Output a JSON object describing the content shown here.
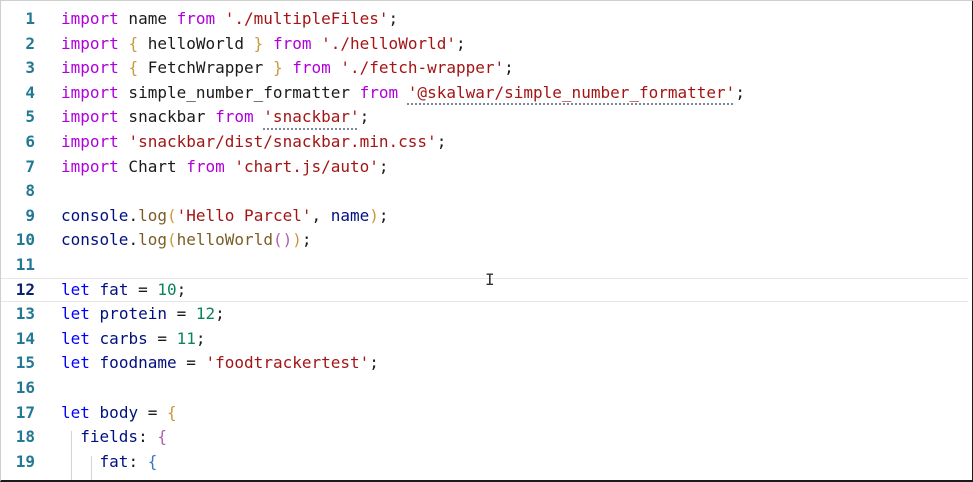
{
  "editor": {
    "lines": [
      {
        "n": "1",
        "tokens": [
          {
            "t": "import",
            "c": "ctrl"
          },
          {
            "t": " name ",
            "c": "plain"
          },
          {
            "t": "from",
            "c": "ctrl"
          },
          {
            "t": " ",
            "c": "plain"
          },
          {
            "t": "'./multipleFiles'",
            "c": "str"
          },
          {
            "t": ";",
            "c": "plain"
          }
        ]
      },
      {
        "n": "2",
        "tokens": [
          {
            "t": "import",
            "c": "ctrl"
          },
          {
            "t": " ",
            "c": "plain"
          },
          {
            "t": "{",
            "c": "br1"
          },
          {
            "t": " helloWorld ",
            "c": "plain"
          },
          {
            "t": "}",
            "c": "br1"
          },
          {
            "t": " ",
            "c": "plain"
          },
          {
            "t": "from",
            "c": "ctrl"
          },
          {
            "t": " ",
            "c": "plain"
          },
          {
            "t": "'./helloWorld'",
            "c": "str"
          },
          {
            "t": ";",
            "c": "plain"
          }
        ]
      },
      {
        "n": "3",
        "tokens": [
          {
            "t": "import",
            "c": "ctrl"
          },
          {
            "t": " ",
            "c": "plain"
          },
          {
            "t": "{",
            "c": "br1"
          },
          {
            "t": " FetchWrapper ",
            "c": "plain"
          },
          {
            "t": "}",
            "c": "br1"
          },
          {
            "t": " ",
            "c": "plain"
          },
          {
            "t": "from",
            "c": "ctrl"
          },
          {
            "t": " ",
            "c": "plain"
          },
          {
            "t": "'./fetch-wrapper'",
            "c": "str"
          },
          {
            "t": ";",
            "c": "plain"
          }
        ]
      },
      {
        "n": "4",
        "tokens": [
          {
            "t": "import",
            "c": "ctrl"
          },
          {
            "t": " simple_number_formatter ",
            "c": "plain"
          },
          {
            "t": "from",
            "c": "ctrl"
          },
          {
            "t": " ",
            "c": "plain"
          },
          {
            "t": "'@skalwar/simple_number_formatter'",
            "c": "str squig"
          },
          {
            "t": ";",
            "c": "plain"
          }
        ]
      },
      {
        "n": "5",
        "tokens": [
          {
            "t": "import",
            "c": "ctrl"
          },
          {
            "t": " snackbar ",
            "c": "plain"
          },
          {
            "t": "from",
            "c": "ctrl"
          },
          {
            "t": " ",
            "c": "plain"
          },
          {
            "t": "'snackbar'",
            "c": "str squig"
          },
          {
            "t": ";",
            "c": "plain"
          }
        ]
      },
      {
        "n": "6",
        "tokens": [
          {
            "t": "import",
            "c": "ctrl"
          },
          {
            "t": " ",
            "c": "plain"
          },
          {
            "t": "'snackbar/dist/snackbar.min.css'",
            "c": "str"
          },
          {
            "t": ";",
            "c": "plain"
          }
        ]
      },
      {
        "n": "7",
        "tokens": [
          {
            "t": "import",
            "c": "ctrl"
          },
          {
            "t": " Chart ",
            "c": "plain"
          },
          {
            "t": "from",
            "c": "ctrl"
          },
          {
            "t": " ",
            "c": "plain"
          },
          {
            "t": "'chart.js/auto'",
            "c": "str"
          },
          {
            "t": ";",
            "c": "plain"
          }
        ]
      },
      {
        "n": "8",
        "tokens": []
      },
      {
        "n": "9",
        "tokens": [
          {
            "t": "console",
            "c": "id"
          },
          {
            "t": ".",
            "c": "plain"
          },
          {
            "t": "log",
            "c": "fn"
          },
          {
            "t": "(",
            "c": "br1"
          },
          {
            "t": "'Hello Parcel'",
            "c": "str"
          },
          {
            "t": ", ",
            "c": "plain"
          },
          {
            "t": "name",
            "c": "id"
          },
          {
            "t": ")",
            "c": "br1"
          },
          {
            "t": ";",
            "c": "plain"
          }
        ]
      },
      {
        "n": "10",
        "tokens": [
          {
            "t": "console",
            "c": "id"
          },
          {
            "t": ".",
            "c": "plain"
          },
          {
            "t": "log",
            "c": "fn"
          },
          {
            "t": "(",
            "c": "br1"
          },
          {
            "t": "helloWorld",
            "c": "fn"
          },
          {
            "t": "()",
            "c": "br2"
          },
          {
            "t": ")",
            "c": "br1"
          },
          {
            "t": ";",
            "c": "plain"
          }
        ]
      },
      {
        "n": "11",
        "tokens": []
      },
      {
        "n": "12",
        "current": true,
        "tokens": [
          {
            "t": "let",
            "c": "kw"
          },
          {
            "t": " ",
            "c": "plain"
          },
          {
            "t": "fat",
            "c": "id"
          },
          {
            "t": " = ",
            "c": "plain"
          },
          {
            "t": "10",
            "c": "num"
          },
          {
            "t": ";",
            "c": "plain"
          }
        ]
      },
      {
        "n": "13",
        "tokens": [
          {
            "t": "let",
            "c": "kw"
          },
          {
            "t": " ",
            "c": "plain"
          },
          {
            "t": "protein",
            "c": "id"
          },
          {
            "t": " = ",
            "c": "plain"
          },
          {
            "t": "12",
            "c": "num"
          },
          {
            "t": ";",
            "c": "plain"
          }
        ]
      },
      {
        "n": "14",
        "tokens": [
          {
            "t": "let",
            "c": "kw"
          },
          {
            "t": " ",
            "c": "plain"
          },
          {
            "t": "carbs",
            "c": "id"
          },
          {
            "t": " = ",
            "c": "plain"
          },
          {
            "t": "11",
            "c": "num"
          },
          {
            "t": ";",
            "c": "plain"
          }
        ]
      },
      {
        "n": "15",
        "tokens": [
          {
            "t": "let",
            "c": "kw"
          },
          {
            "t": " ",
            "c": "plain"
          },
          {
            "t": "foodname",
            "c": "id"
          },
          {
            "t": " = ",
            "c": "plain"
          },
          {
            "t": "'foodtrackertest'",
            "c": "str"
          },
          {
            "t": ";",
            "c": "plain"
          }
        ]
      },
      {
        "n": "16",
        "tokens": []
      },
      {
        "n": "17",
        "tokens": [
          {
            "t": "let",
            "c": "kw"
          },
          {
            "t": " ",
            "c": "plain"
          },
          {
            "t": "body",
            "c": "id"
          },
          {
            "t": " = ",
            "c": "plain"
          },
          {
            "t": "{",
            "c": "br1"
          }
        ]
      },
      {
        "n": "18",
        "tokens": [
          {
            "t": "  ",
            "c": "plain"
          },
          {
            "t": "fields",
            "c": "prop"
          },
          {
            "t": ": ",
            "c": "plain"
          },
          {
            "t": "{",
            "c": "br2"
          }
        ]
      },
      {
        "n": "19",
        "tokens": [
          {
            "t": "    ",
            "c": "plain"
          },
          {
            "t": "fat",
            "c": "prop"
          },
          {
            "t": ": ",
            "c": "plain"
          },
          {
            "t": "{",
            "c": "br3"
          }
        ]
      }
    ],
    "cursor_glyph": "I"
  }
}
